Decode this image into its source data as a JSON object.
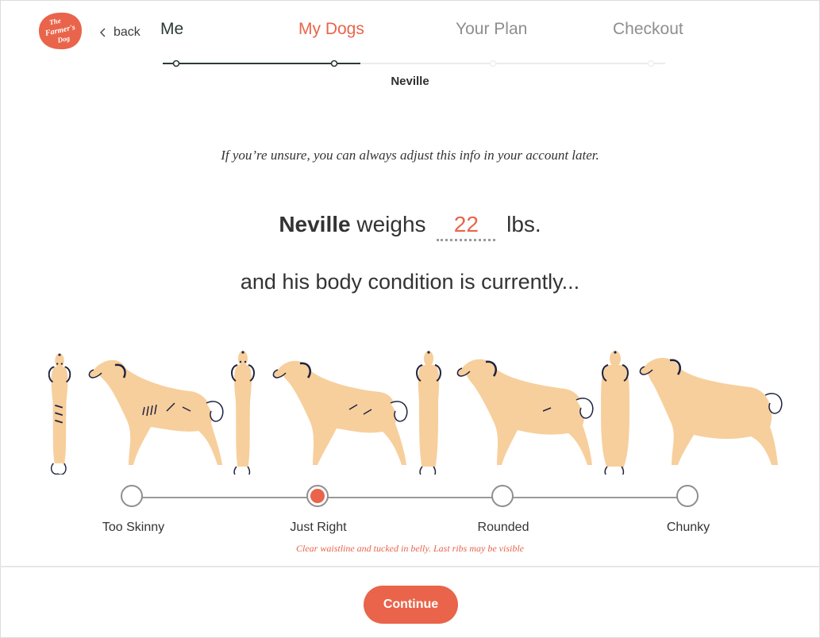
{
  "brand": {
    "logo_lines": [
      "The",
      "Farmer's",
      "Dog"
    ],
    "accent_color": "#e9644a",
    "dark_green": "#2b3b35"
  },
  "header": {
    "back_label": "back",
    "tabs": [
      {
        "label": "Me",
        "state": "completed"
      },
      {
        "label": "My Dogs",
        "state": "active"
      },
      {
        "label": "Your Plan",
        "state": "upcoming"
      },
      {
        "label": "Checkout",
        "state": "upcoming"
      }
    ],
    "sub_step": "Neville"
  },
  "main": {
    "hint": "If you’re unsure, you can always adjust this info in your account later.",
    "dog_name": "Neville",
    "weighs_text": "weighs",
    "weight_value": "22",
    "weight_unit": "lbs.",
    "condition_prompt": "and his body condition is currently...",
    "options": [
      {
        "label": "Too Skinny"
      },
      {
        "label": "Just Right",
        "selected": true
      },
      {
        "label": "Rounded"
      },
      {
        "label": "Chunky"
      }
    ],
    "selected_description": "Clear waistline and tucked in belly. Last ribs may be visible"
  },
  "footer": {
    "continue_label": "Continue"
  }
}
